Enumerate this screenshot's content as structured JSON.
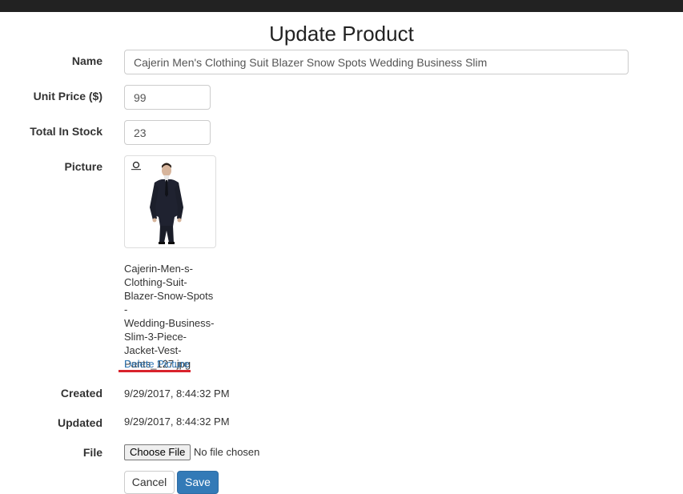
{
  "page": {
    "title": "Update Product"
  },
  "form": {
    "name_label": "Name",
    "name_value": "Cajerin Men's Clothing Suit Blazer Snow Spots Wedding Business Slim",
    "price_label": "Unit Price ($)",
    "price_value": "99",
    "stock_label": "Total In Stock",
    "stock_value": "23",
    "picture_label": "Picture",
    "picture_filename_lines": [
      "Cajerin-Men-s-",
      "Clothing-Suit-",
      "Blazer-Snow-Spots-",
      "Wedding-Business-",
      "Slim-3-Piece-",
      "Jacket-Vest-",
      "Pants_127.jpg"
    ],
    "delete_picture_label": "Delete Picture",
    "created_label": "Created",
    "created_value": "9/29/2017, 8:44:32 PM",
    "updated_label": "Updated",
    "updated_value": "9/29/2017, 8:44:32 PM",
    "file_label": "File",
    "choose_file_label": "Choose File",
    "no_file_text": "No file chosen",
    "cancel_label": "Cancel",
    "save_label": "Save"
  },
  "colors": {
    "primary": "#337ab7",
    "annotation_underline": "#d9232d",
    "topbar": "#222222"
  }
}
